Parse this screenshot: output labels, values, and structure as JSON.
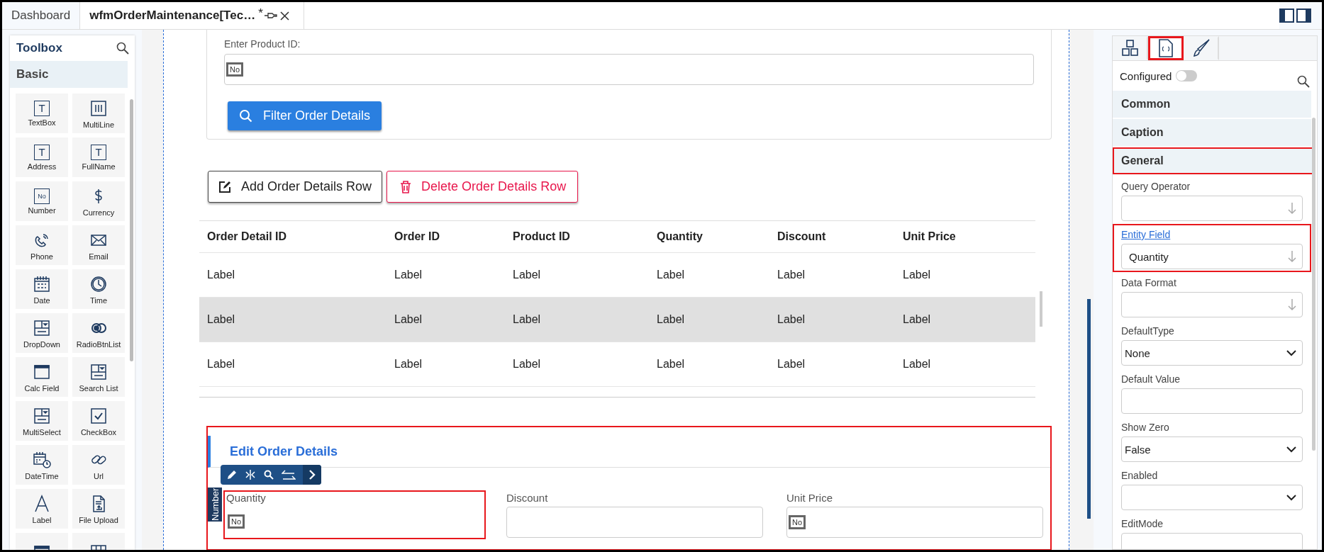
{
  "tabs": [
    {
      "label": "Dashboard",
      "selected": false
    },
    {
      "label": "wfmOrderMaintenance[Tec…",
      "modified": "*",
      "selected": true
    }
  ],
  "toolbox": {
    "title": "Toolbox",
    "group": "Basic",
    "items": [
      {
        "label": "TextBox",
        "kind": "glyph",
        "glyph": "T"
      },
      {
        "label": "MultiLine",
        "kind": "multiline"
      },
      {
        "label": "Address",
        "kind": "glyph",
        "glyph": "T"
      },
      {
        "label": "FullName",
        "kind": "glyph",
        "glyph": "T"
      },
      {
        "label": "Number",
        "kind": "glyph",
        "glyph": "No"
      },
      {
        "label": "Currency",
        "kind": "currency"
      },
      {
        "label": "Phone",
        "kind": "phone"
      },
      {
        "label": "Email",
        "kind": "email"
      },
      {
        "label": "Date",
        "kind": "date"
      },
      {
        "label": "Time",
        "kind": "time"
      },
      {
        "label": "DropDown",
        "kind": "dropdown"
      },
      {
        "label": "RadioBtnList",
        "kind": "radio"
      },
      {
        "label": "Calc Field",
        "kind": "window"
      },
      {
        "label": "Search List",
        "kind": "dropdown"
      },
      {
        "label": "MultiSelect",
        "kind": "dropdown"
      },
      {
        "label": "CheckBox",
        "kind": "checkbox"
      },
      {
        "label": "DateTime",
        "kind": "datetime"
      },
      {
        "label": "Url",
        "kind": "link"
      },
      {
        "label": "Label",
        "kind": "letter"
      },
      {
        "label": "File Upload",
        "kind": "upload"
      },
      {
        "kind": "window"
      },
      {
        "kind": "grid"
      }
    ]
  },
  "filter_card": {
    "label": "Enter Product ID:",
    "badge": "No",
    "button": "Filter Order Details"
  },
  "actions": [
    {
      "label": "Add Order Details Row",
      "kind": "add"
    },
    {
      "label": "Delete Order Details Row",
      "kind": "delete"
    }
  ],
  "table": {
    "columns": [
      "Order Detail ID",
      "Order ID",
      "Product ID",
      "Quantity",
      "Discount",
      "Unit Price"
    ],
    "rows": [
      {
        "cells": [
          "Label",
          "Label",
          "Label",
          "Label",
          "Label",
          "Label"
        ],
        "hovered": false
      },
      {
        "cells": [
          "Label",
          "Label",
          "Label",
          "Label",
          "Label",
          "Label"
        ],
        "hovered": true
      },
      {
        "cells": [
          "Label",
          "Label",
          "Label",
          "Label",
          "Label",
          "Label"
        ],
        "hovered": false
      }
    ]
  },
  "edit_section": {
    "title": "Edit Order Details",
    "highlighted": true,
    "type_tag": "Number",
    "fields": [
      {
        "label": "Quantity",
        "badge": "No",
        "selected": true
      },
      {
        "label": "Discount",
        "selected": false
      },
      {
        "label": "Unit Price",
        "badge": "No",
        "selected": false
      }
    ]
  },
  "properties": {
    "tabs": [
      {
        "kind": "layout",
        "selected": false
      },
      {
        "kind": "code",
        "selected": true
      },
      {
        "kind": "style",
        "selected": false
      }
    ],
    "configured": {
      "label": "Configured",
      "on": false
    },
    "sections": [
      {
        "label": "Common",
        "highlighted": false
      },
      {
        "label": "Caption",
        "highlighted": false
      },
      {
        "label": "General",
        "highlighted": true
      }
    ],
    "fields": [
      {
        "label": "Query Operator",
        "kind": "lookup",
        "link": false,
        "highlighted": false
      },
      {
        "label": "Entity Field",
        "kind": "lookup",
        "link": true,
        "value": "Quantity",
        "highlighted": true
      },
      {
        "label": "Data Format",
        "kind": "lookup",
        "link": false,
        "highlighted": false
      },
      {
        "label": "DefaultType",
        "kind": "select",
        "value": "None",
        "link": false,
        "highlighted": false
      },
      {
        "label": "Default Value",
        "kind": "text",
        "link": false,
        "highlighted": false
      },
      {
        "label": "Show Zero",
        "kind": "select",
        "value": "False",
        "link": false,
        "highlighted": false
      },
      {
        "label": "Enabled",
        "kind": "select",
        "link": false,
        "highlighted": false
      },
      {
        "label": "EditMode",
        "kind": "text",
        "link": false,
        "highlighted": false
      }
    ]
  }
}
